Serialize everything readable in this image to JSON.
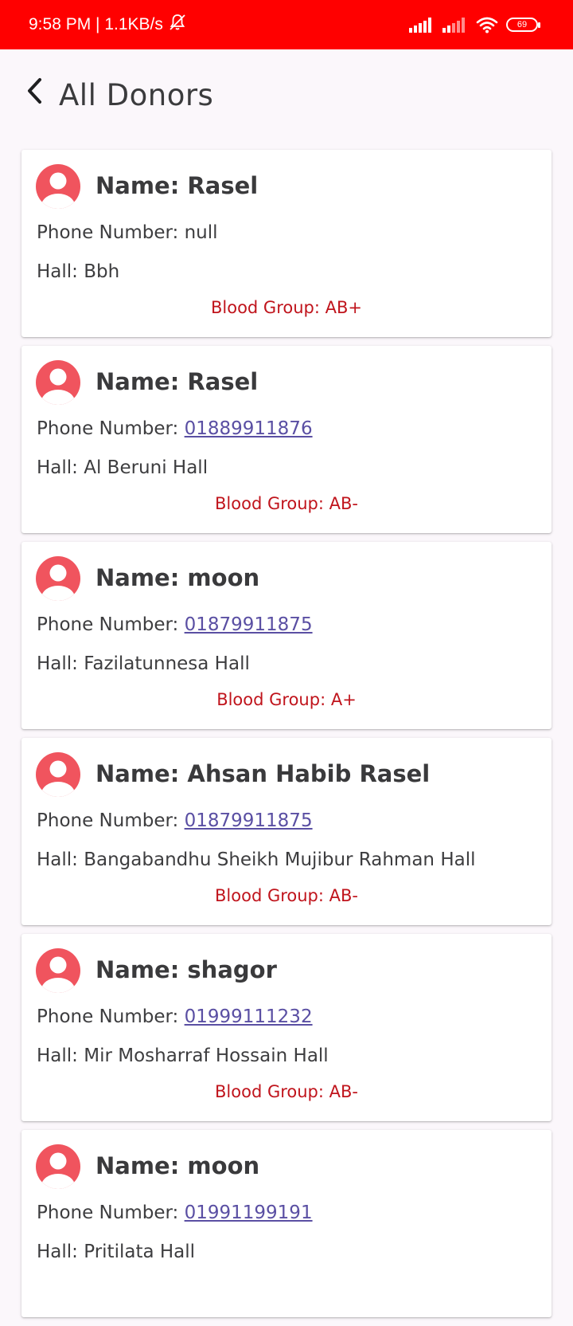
{
  "status_bar": {
    "time_speed": "9:58 PM | 1.1KB/s",
    "battery": "69",
    "bell_icon": "bell-off-icon",
    "signal_icon": "signal-icon",
    "wifi_icon": "wifi-icon"
  },
  "header": {
    "title": "All Donors",
    "back_icon": "chevron-left-icon"
  },
  "colors": {
    "status_bar": "#ff0000",
    "avatar": "#f0545e",
    "blood_group": "#c0141c",
    "link": "#5a4fa3"
  },
  "labels": {
    "name": "Name: ",
    "phone": "Phone Number: ",
    "hall": "Hall: ",
    "blood": "Blood Group: "
  },
  "donors": [
    {
      "name": "Rasel",
      "phone": "null",
      "phone_is_link": false,
      "hall": "Bbh",
      "blood_group": "AB+"
    },
    {
      "name": "Rasel",
      "phone": "01889911876",
      "phone_is_link": true,
      "hall": "Al Beruni Hall",
      "blood_group": "AB-"
    },
    {
      "name": "moon",
      "phone": "01879911875",
      "phone_is_link": true,
      "hall": "Fazilatunnesa Hall",
      "blood_group": "A+"
    },
    {
      "name": "Ahsan Habib Rasel",
      "phone": "01879911875",
      "phone_is_link": true,
      "hall": "Bangabandhu Sheikh Mujibur Rahman Hall",
      "blood_group": "AB-"
    },
    {
      "name": "shagor",
      "phone": "01999111232",
      "phone_is_link": true,
      "hall": "Mir Mosharraf Hossain Hall",
      "blood_group": "AB-"
    },
    {
      "name": "moon",
      "phone": "01991199191",
      "phone_is_link": true,
      "hall": "Pritilata Hall",
      "blood_group": ""
    }
  ]
}
